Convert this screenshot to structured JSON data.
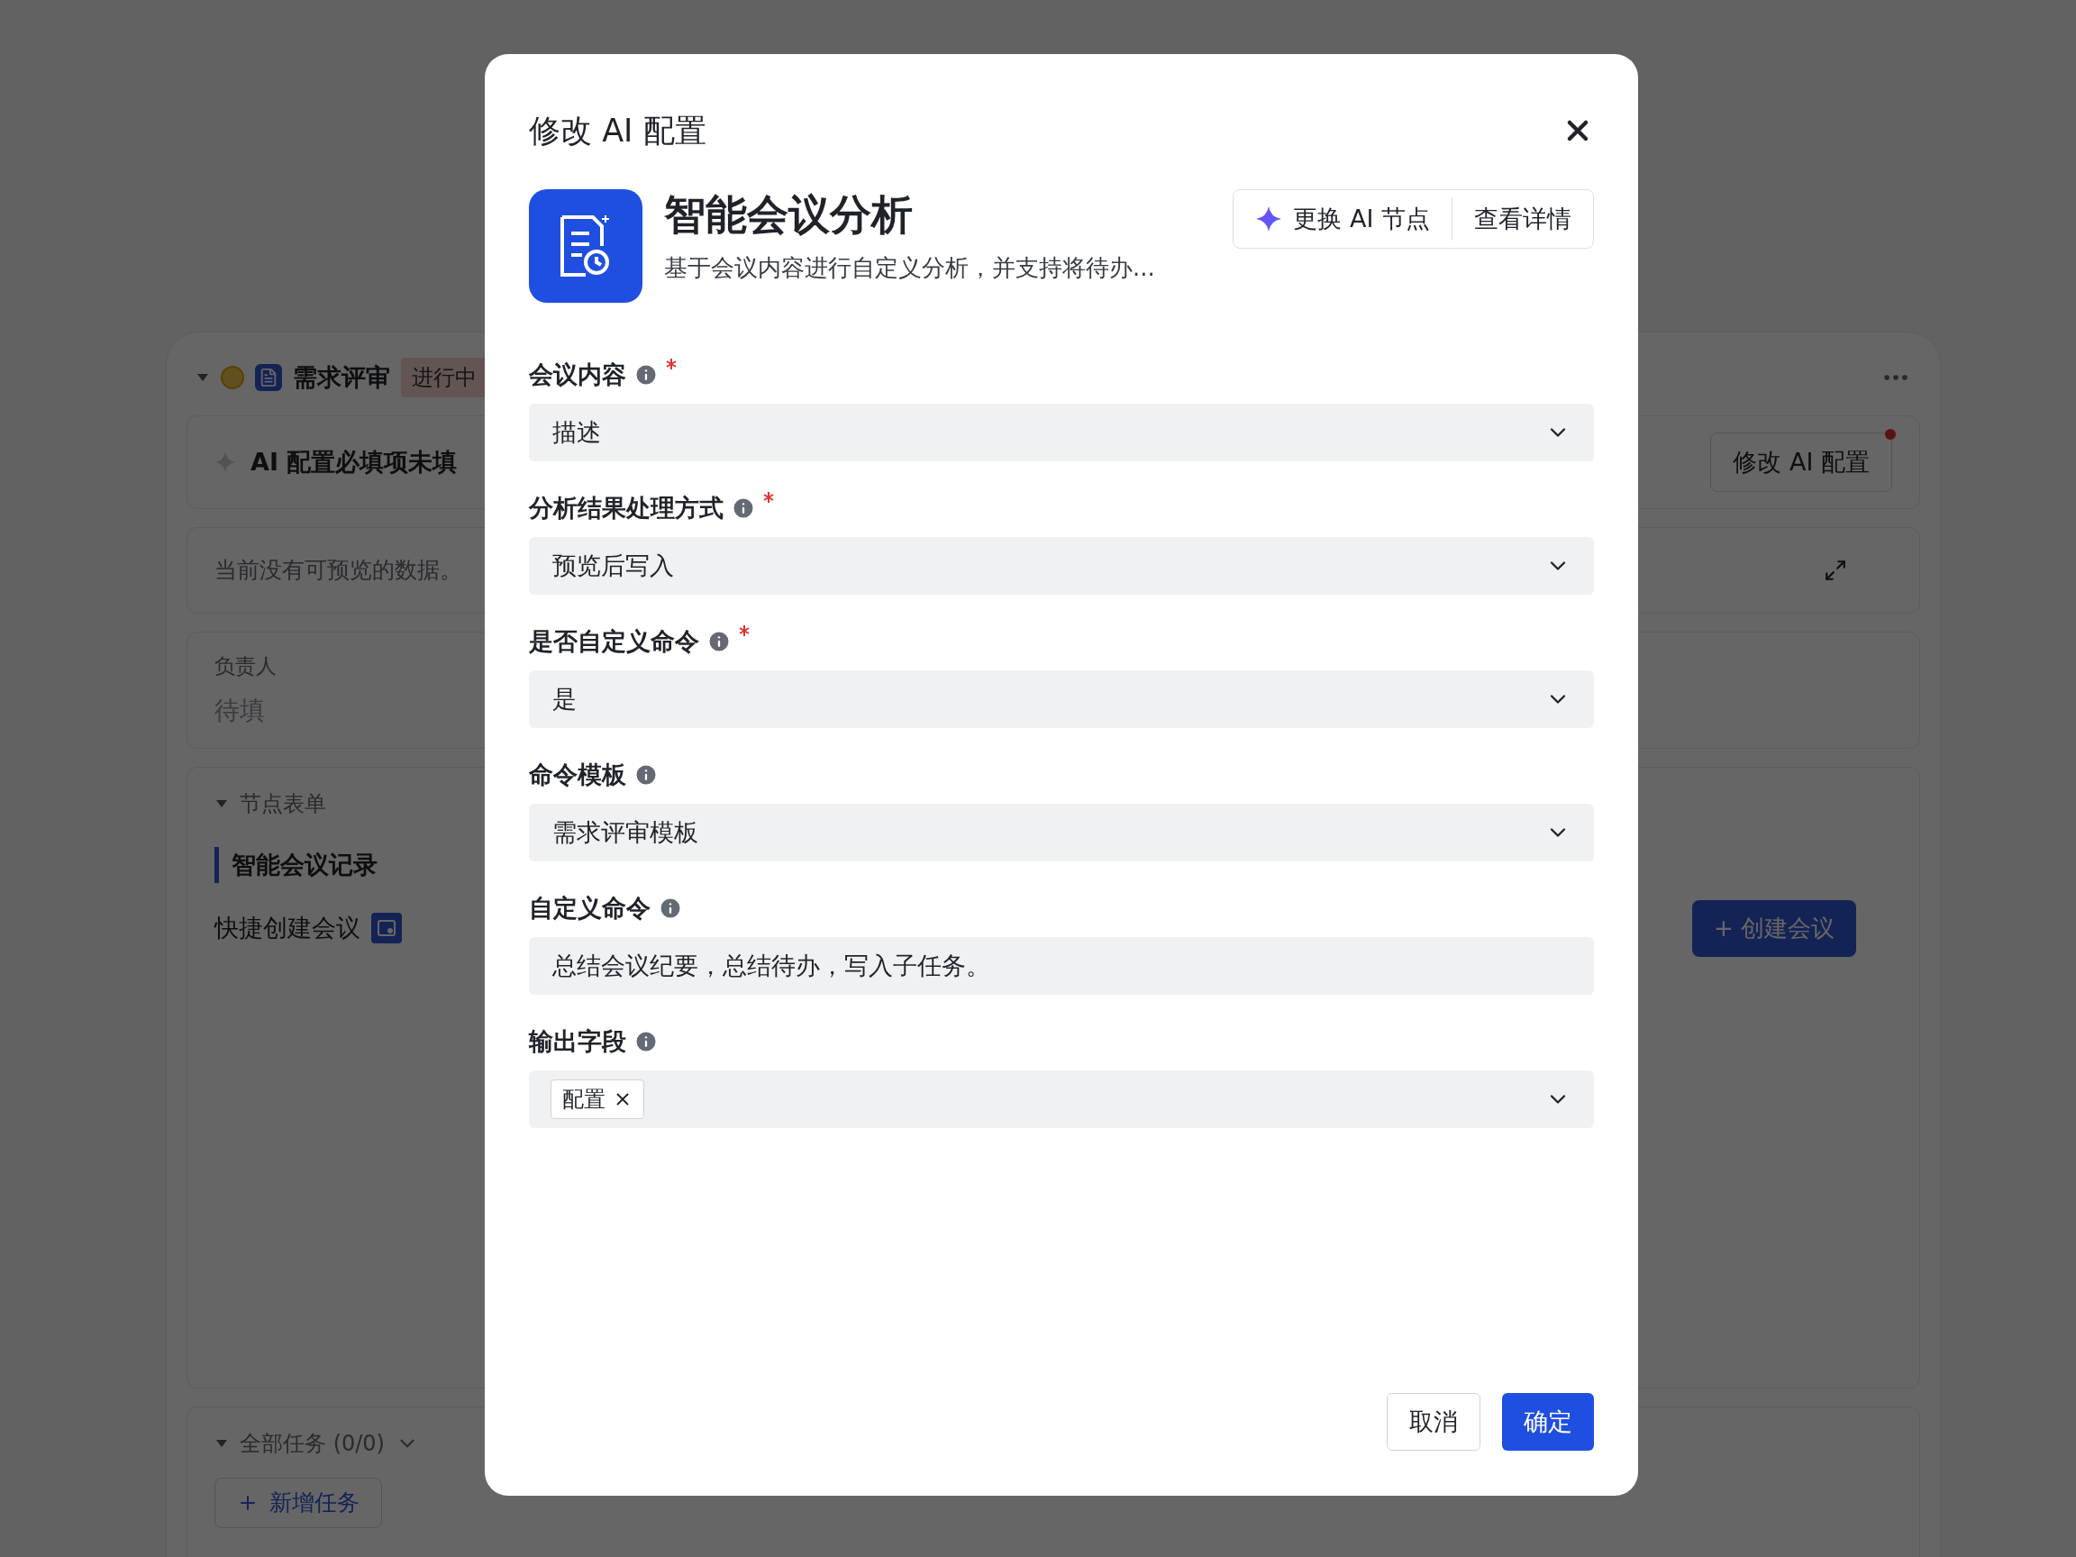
{
  "background": {
    "node": {
      "title": "需求评审",
      "status": "进行中",
      "expanded": true
    },
    "ai_notice": "AI 配置必填项未填",
    "ai_button": "修改 AI 配置",
    "preview_empty": "当前没有可预览的数据。",
    "owner": {
      "label": "负责人",
      "value": "待填"
    },
    "form_section": {
      "title": "节点表单",
      "expanded": true,
      "items": [
        {
          "label": "智能会议记录",
          "selected": true
        },
        {
          "label": "快捷创建会议",
          "selected": false
        }
      ],
      "create_button": "+ 创建会议"
    },
    "tasks": {
      "title": "全部任务 (0/0)",
      "expanded": true,
      "add_button": "新增任务"
    }
  },
  "dialog": {
    "title": "修改 AI 配置",
    "node": {
      "name": "智能会议分析",
      "description": "基于会议内容进行自定义分析，并支持将待办...",
      "actions": [
        "更换 AI 节点",
        "查看详情"
      ]
    },
    "fields": [
      {
        "label": "会议内容",
        "required": true,
        "kind": "select",
        "value": "描述"
      },
      {
        "label": "分析结果处理方式",
        "required": true,
        "kind": "select",
        "value": "预览后写入"
      },
      {
        "label": "是否自定义命令",
        "required": true,
        "kind": "select",
        "value": "是"
      },
      {
        "label": "命令模板",
        "required": false,
        "kind": "select",
        "value": "需求评审模板"
      },
      {
        "label": "自定义命令",
        "required": false,
        "kind": "text",
        "value": "总结会议纪要，总结待办，写入子任务。"
      },
      {
        "label": "输出字段",
        "required": false,
        "kind": "tags",
        "tags": [
          "配置"
        ]
      }
    ],
    "buttons": [
      {
        "label": "取消",
        "primary": false
      },
      {
        "label": "确定",
        "primary": true
      }
    ]
  }
}
